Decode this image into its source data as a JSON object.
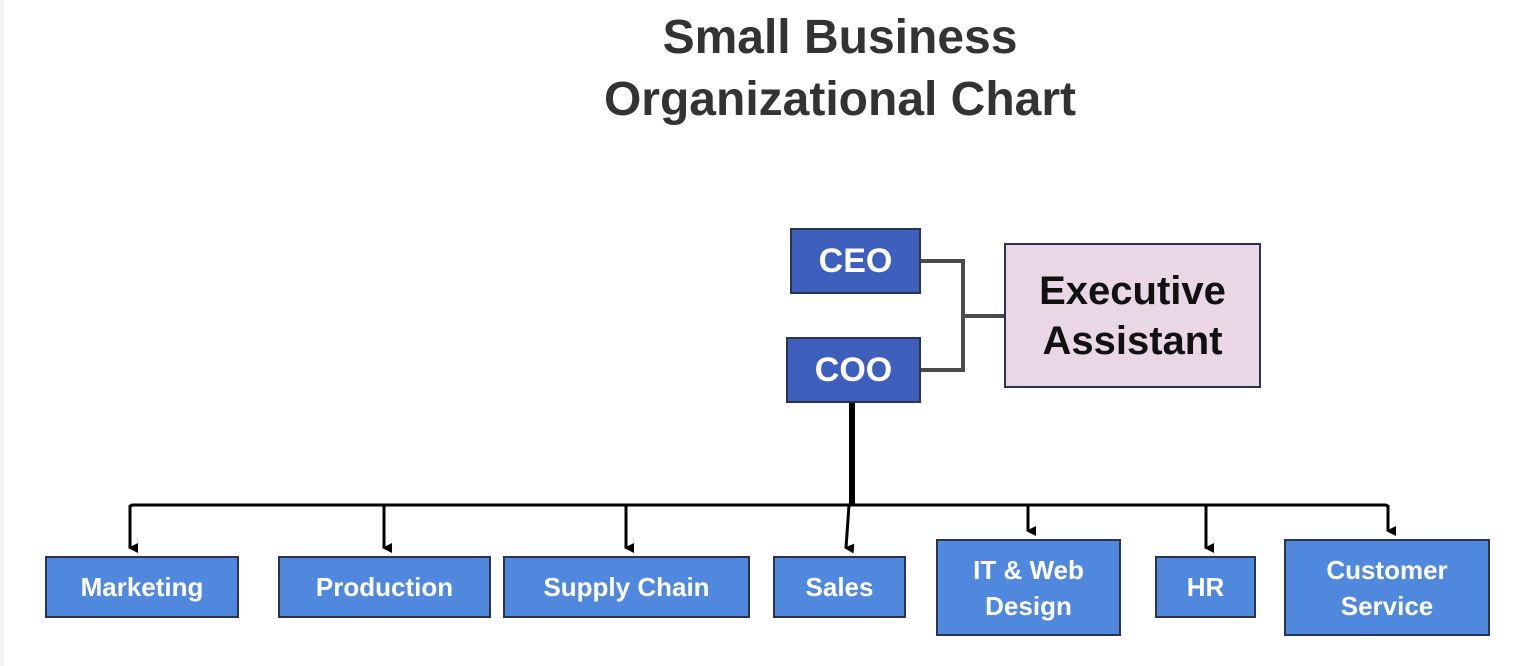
{
  "title": {
    "line1": "Small Business",
    "line2": "Organizational Chart"
  },
  "executives": {
    "ceo": "CEO",
    "coo": "COO",
    "assistant_line1": "Executive",
    "assistant_line2": "Assistant"
  },
  "departments": [
    {
      "line1": "Marketing",
      "line2": ""
    },
    {
      "line1": "Production",
      "line2": ""
    },
    {
      "line1": "Supply Chain",
      "line2": ""
    },
    {
      "line1": "Sales",
      "line2": ""
    },
    {
      "line1": "IT & Web",
      "line2": "Design"
    },
    {
      "line1": "HR",
      "line2": ""
    },
    {
      "line1": "Customer",
      "line2": "Service"
    }
  ],
  "colors": {
    "executive_box": "#3f5fbd",
    "department_box": "#4f88dd",
    "assistant_box": "#ead7e5",
    "border": "#2a3450",
    "title_text": "#333333"
  }
}
